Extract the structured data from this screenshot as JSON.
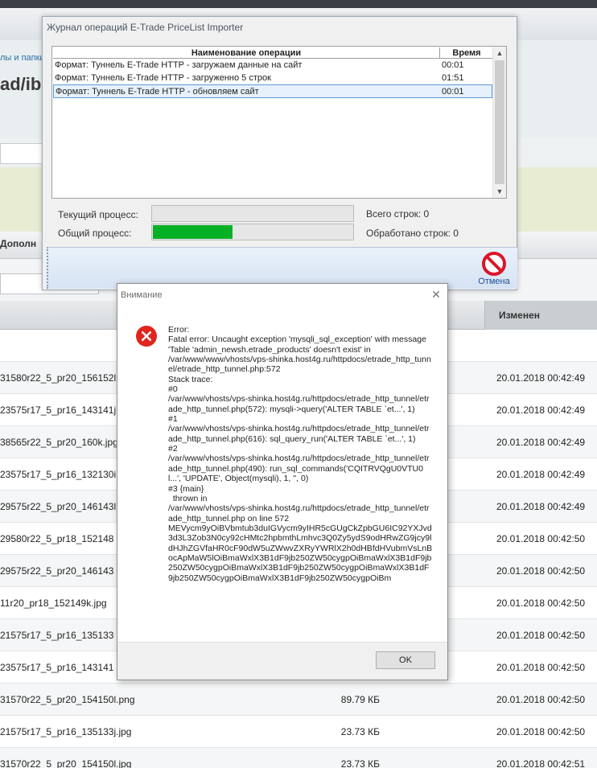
{
  "background": {
    "breadcrumb": "лы и папки",
    "page_title": "ad/ibl",
    "tab_label": "Дополн",
    "column_changed": "Изменен",
    "rows": [
      {
        "name": "",
        "size": "",
        "date": ""
      },
      {
        "name": "31580r22_5_pr20_156152l",
        "size": "",
        "date": "20.01.2018 00:42:49"
      },
      {
        "name": "23575r17_5_pr16_143141j",
        "size": "",
        "date": "20.01.2018 00:42:49"
      },
      {
        "name": "38565r22_5_pr20_160k.jpg",
        "size": "",
        "date": "20.01.2018 00:42:49"
      },
      {
        "name": "23575r17_5_pr16_132130i",
        "size": "",
        "date": "20.01.2018 00:42:49"
      },
      {
        "name": "29575r22_5_pr20_146143l",
        "size": "",
        "date": "20.01.2018 00:42:49"
      },
      {
        "name": "29580r22_5_pr18_152148",
        "size": "",
        "date": "20.01.2018 00:42:50"
      },
      {
        "name": "29575r22_5_pr20_146143",
        "size": "",
        "date": "20.01.2018 00:42:50"
      },
      {
        "name": "11r20_pr18_152149k.jpg",
        "size": "",
        "date": "20.01.2018 00:42:50"
      },
      {
        "name": "21575r17_5_pr16_135133",
        "size": "",
        "date": "20.01.2018 00:42:50"
      },
      {
        "name": "23575r17_5_pr16_143141",
        "size": "",
        "date": "20.01.2018 00:42:50"
      },
      {
        "name": "31570r22_5_pr20_154150l.png",
        "size": "89.79 КБ",
        "date": "20.01.2018 00:42:50"
      },
      {
        "name": "21575r17_5_pr16_135133j.jpg",
        "size": "23.73 КБ",
        "date": "20.01.2018 00:42:50"
      },
      {
        "name": "31570r22_5_pr20_154150l.jpg",
        "size": "23.73 КБ",
        "date": "20.01.2018 00:42:51"
      }
    ]
  },
  "journal": {
    "title": "Журнал операций E-Trade PriceList Importer",
    "col_name": "Наименование операции",
    "col_time": "Время",
    "rows": [
      {
        "name": "Формат: Туннель E-Trade HTTP - загружаем данные на сайт",
        "time": "00:01"
      },
      {
        "name": "Формат: Туннель E-Trade HTTP - загруженно 5 строк",
        "time": "01:51"
      },
      {
        "name": "Формат: Туннель E-Trade HTTP - обновляем сайт",
        "time": "00:01"
      }
    ],
    "current_process_label": "Текущий процесс:",
    "total_process_label": "Общий процесс:",
    "current_progress": 0,
    "total_progress": 0.4,
    "total_rows_label": "Всего строк: 0",
    "processed_rows_label": "Обработано строк: 0",
    "cancel_label": "Отмена",
    "colors": {
      "progress": "#06b025",
      "cancel_icon": "#d9152b"
    }
  },
  "alert": {
    "title": "Внимание",
    "close_glyph": "✕",
    "message": "Error:\nFatal error: Uncaught exception 'mysqli_sql_exception' with message 'Table 'admin_newsh.etrade_products' doesn't exist' in\n/var/www/www/vhosts/vps-shinka.host4g.ru/httpdocs/etrade_http_tunnel/etrade_http_tunnel.php:572\nStack trace:\n#0\n/var/www/vhosts/vps-shinka.host4g.ru/httpdocs/etrade_http_tunnel/etrade_http_tunnel.php(572): mysqli->query('ALTER TABLE `et...', 1)\n#1\n/var/www/vhosts/vps-shinka.host4g.ru/httpdocs/etrade_http_tunnel/etrade_http_tunnel.php(616): sql_query_run('ALTER TABLE `et...', 1)\n#2\n/var/www/vhosts/vps-shinka.host4g.ru/httpdocs/etrade_http_tunnel/etrade_http_tunnel.php(490): run_sql_commands('CQITRVQgU0VTU0l...', 'UPDATE', Object(mysqli), 1, '', 0)\n#3 {main}\n  thrown in\n/var/www/vhosts/vps-shinka.host4g.ru/httpdocs/etrade_http_tunnel/etrade_http_tunnel.php on line 572\nMEVycm9yOiBVbmtub3duIGVycm9yIHR5cGUgCkZpbGU6IC92YXJvd3d3L3Zob3N0cy92cHMtc2hpbmthLmhvc3Q0Zy5ydS9odHRwZG9jcy9ldHJhZGVfaHR0cF90dW5uZWwvZXRyYWRlX2h0dHBfdHVubmVsLnBocApMaW5lOiBmaWxlX3B1dF9jb250ZW50cygpOiBmaWxlX3B1dF9jb250ZW50cygpOiBmaWxlX3B1dF9jb250ZW50cygpOiBmaWxlX3B1dF9jb250ZW50cygpOiBmaWxlX3B1dF9jb250ZW50cygpOiBm",
    "ok_label": "OK",
    "colors": {
      "error_icon": "#e0251d"
    }
  }
}
